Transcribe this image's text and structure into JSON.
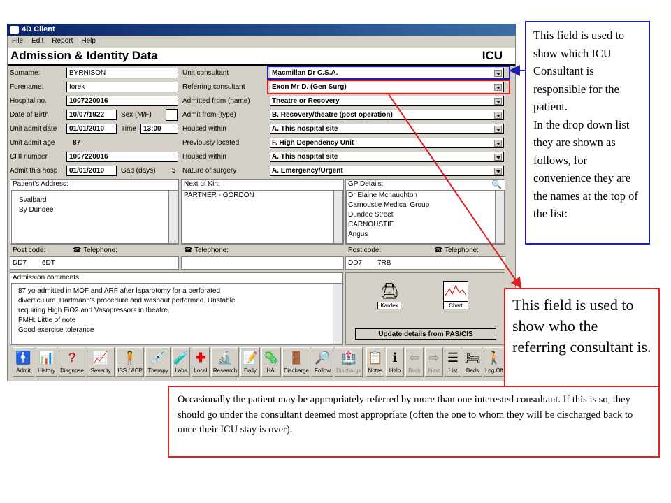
{
  "app_title": "4D Client",
  "menu": [
    "File",
    "Edit",
    "Report",
    "Help"
  ],
  "header": {
    "title": "Admission & Identity Data",
    "unit": "ICU"
  },
  "left_fields": [
    {
      "label": "Surname:",
      "value": "BYRNISON"
    },
    {
      "label": "Forename:",
      "value": "Iorek"
    },
    {
      "label": "Hospital no.",
      "value": "1007220016"
    },
    {
      "label": "Date of Birth",
      "value": "10/07/1922"
    },
    {
      "label": "Unit admit date",
      "value": "01/01/2010"
    },
    {
      "label": "Unit admit age",
      "value": "87"
    },
    {
      "label": "CHI number",
      "value": "1007220016"
    },
    {
      "label": "Admit this hosp",
      "value": "01/01/2010"
    }
  ],
  "sex": {
    "label": "Sex (M/F)",
    "value": ""
  },
  "time": {
    "label": "Time",
    "value": "13:00"
  },
  "gap": {
    "label": "Gap (days)",
    "value": "5"
  },
  "right_fields": [
    {
      "label": "Unit consultant",
      "value": "Macmillan Dr C.S.A."
    },
    {
      "label": "Referring consultant",
      "value": "Exon Mr D. (Gen Surg)"
    },
    {
      "label": "Admitted from (name)",
      "value": "Theatre or Recovery"
    },
    {
      "label": "Admit from (type)",
      "value": "B. Recovery/theatre (post operation)"
    },
    {
      "label": "Housed within",
      "value": "A. This hospital site"
    },
    {
      "label": "Previously located",
      "value": "F. High Dependency Unit"
    },
    {
      "label": "Housed within",
      "value": "A. This hospital site"
    },
    {
      "label": "Nature of surgery",
      "value": "A. Emergency/Urgent"
    }
  ],
  "address": {
    "label": "Patient's Address:",
    "lines": "Svalbard\nBy Dundee",
    "postcode_label": "Post code:",
    "postcode1": "DD7",
    "postcode2": "6DT",
    "tel_label": "Telephone:"
  },
  "kin": {
    "label": "Next of Kin:",
    "value": "PARTNER - GORDON",
    "tel_label": "Telephone:"
  },
  "gp": {
    "label": "GP Details:",
    "lines": "Dr Elaine Mcnaughton\nCarnoustie Medical Group\nDundee Street\nCARNOUSTIE\nAngus",
    "postcode_label": "Post code:",
    "postcode1": "DD7",
    "postcode2": "7RB",
    "tel_label": "Telephone:"
  },
  "comments": {
    "label": "Admission comments:",
    "text": "87 yo admitted in MOF and ARF after laparotomy for a perforated\ndiverticulum. Hartmann's procedure and washout performed. Unstable\nrequiring High FiO2 and Vasopressors in theatre.\nPMH: Little of note\nGood exercise tolerance"
  },
  "kardex_label": "Kardex",
  "chart_label": "Chart",
  "update_button": "Update details from PAS/CIS",
  "toolbar": [
    "Admit",
    "History",
    "Diagnose",
    "Severity",
    "ISS / ACP",
    "Therapy",
    "Labs",
    "Local",
    "Research",
    "Daily",
    "HAI",
    "Discharge",
    "Follow",
    "Discharge",
    "Notes",
    "Help",
    "Back",
    "Next",
    "List",
    "Beds",
    "Log Off"
  ],
  "annotations": {
    "blue": "This field is used to show which ICU Consultant is responsible for the patient.\nIn the drop down list they are shown as follows, for convenience they are the names at the top of the list:",
    "red": "This field is used to show who the referring consultant is.",
    "bottom": "Occasionally the patient may be appropriately referred by more than one interested consultant. If this is so, they should go under the consultant deemed most appropriate (often the one to whom they will be discharged back to once their ICU stay is over)."
  },
  "colors": {
    "blue": "#1f1fb4",
    "red": "#e02020",
    "titlebar": "#0a246a"
  }
}
